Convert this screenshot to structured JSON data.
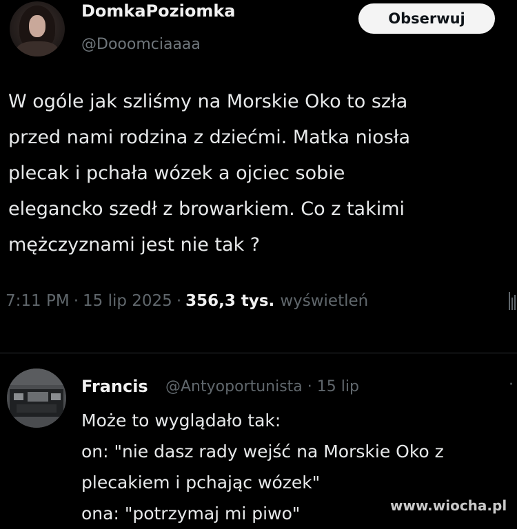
{
  "tweet": {
    "author": {
      "display_name": "DomkaPoziomka",
      "handle": "@Dooomciaaaa",
      "avatar_icon": "user-avatar-icon"
    },
    "follow_label": "Obserwuj",
    "text_lines": [
      "W ogóle jak szliśmy na Morskie Oko to szła",
      "przed nami rodzina z dziećmi. Matka niosła",
      "plecak i pchała wózek a ojciec sobie",
      "elegancko szedł z browarkiem. Co z takimi",
      "mężczyznami jest nie tak ?"
    ],
    "meta": {
      "time": "7:11 PM",
      "separator": "·",
      "date": "15 lip 2025",
      "views_count": "356,3 tys.",
      "views_label": "wyświetleń"
    },
    "stats_icon": "stats-icon"
  },
  "reply": {
    "author": {
      "display_name": "Francis",
      "handle_and_date": "@Antyoportunista · 15 lip",
      "avatar_icon": "user-avatar-icon"
    },
    "more_icon": "more-dots-icon",
    "text_lines": [
      "Może to wyglądało tak:",
      "on: \"nie dasz rady wejść na Morskie Oko z",
      "plecakiem i pchając wózek\"",
      "ona: \"potrzymaj mi piwo\""
    ]
  },
  "watermark": "www.wiocha.pl",
  "colors": {
    "background": "#000000",
    "text": "#e7e9ea",
    "muted": "#60676c",
    "button_bg": "#f4f4f4",
    "divider": "#2f3336"
  }
}
